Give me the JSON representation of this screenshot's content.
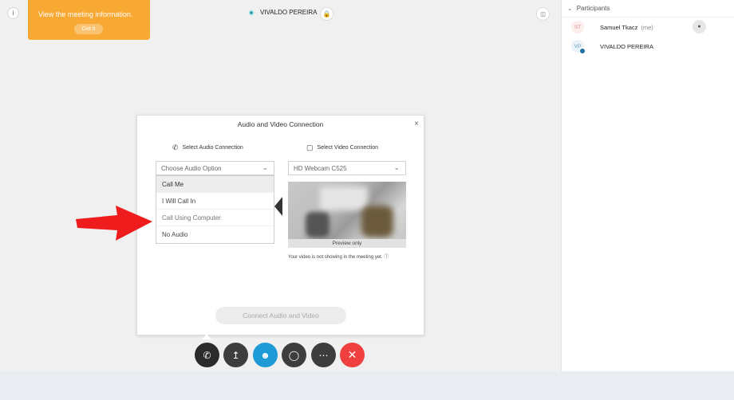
{
  "topbar": {
    "info_icon": "info-icon",
    "tooltip_text": "View the meeting information.",
    "tooltip_button": "Got it",
    "host_name": "VIVALDO PEREIRA",
    "lock_icon": "lock-icon",
    "layout_icon": "layout-icon"
  },
  "participants": {
    "header": "Participants",
    "items": [
      {
        "initials": "ST",
        "name": "Samuel Tkacz",
        "tag": "(me)",
        "icon": "mic-icon"
      },
      {
        "initials": "VP",
        "name": "VIVALDO PEREIRA",
        "tag": ""
      }
    ]
  },
  "dialog": {
    "title": "Audio and Video Connection",
    "close": "×",
    "audio_section": "Select Audio Connection",
    "video_section": "Select Video Connection",
    "audio_select_placeholder": "Choose Audio Option",
    "audio_options": [
      "Call Me",
      "I Will Call In",
      "Call Using Computer",
      "No Audio"
    ],
    "video_select_value": "HD Webcam C525",
    "preview_label": "Preview only",
    "video_note": "Your video is not showing in the meeting yet.",
    "connect_button": "Connect Audio and Video"
  },
  "controls": [
    {
      "name": "audio-button",
      "icon": "phone-icon"
    },
    {
      "name": "share-button",
      "icon": "upload-icon"
    },
    {
      "name": "participants-button",
      "icon": "add-person-icon"
    },
    {
      "name": "chat-button",
      "icon": "chat-icon"
    },
    {
      "name": "more-button",
      "icon": "more-icon"
    },
    {
      "name": "end-meeting-button",
      "icon": "close-icon"
    }
  ],
  "colors": {
    "tooltip": "#f7a934",
    "participants_button": "#1e9ad6",
    "end_button": "#ef3f3f",
    "annotation_arrow": "#ee1c1c"
  }
}
